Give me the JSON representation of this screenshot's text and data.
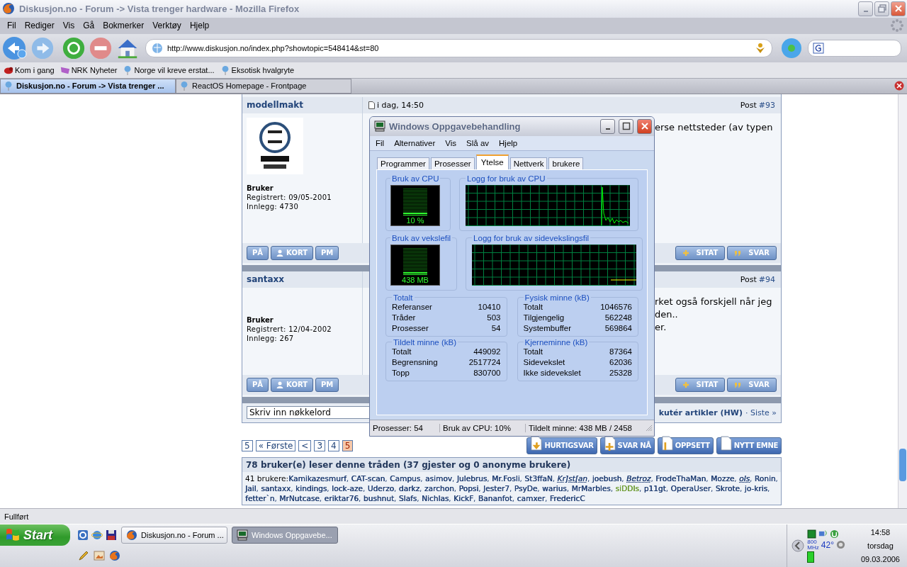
{
  "browser": {
    "title": "Diskusjon.no - Forum -> Vista trenger hardware - Mozilla Firefox",
    "menu": [
      "Fil",
      "Rediger",
      "Vis",
      "Gå",
      "Bokmerker",
      "Verktøy",
      "Hjelp"
    ],
    "url": "http://www.diskusjon.no/index.php?showtopic=548414&st=80",
    "bookmarks": [
      "Kom i gang",
      "NRK Nyheter",
      "Norge vil kreve erstat...",
      "Eksotisk hvalgryte"
    ],
    "tabs": [
      {
        "label": "Diskusjon.no - Forum -> Vista trenger ...",
        "selected": true
      },
      {
        "label": "ReactOS Homepage - Frontpage",
        "selected": false
      }
    ],
    "status": "Fullført"
  },
  "forum": {
    "posts": [
      {
        "author": "modellmakt",
        "date": "i dag, 14:50",
        "post_word": "Post",
        "number": "#93",
        "avatar": {
          "kind": "picture"
        },
        "rank": "Bruker",
        "registered": "Registrert: 09/05-2001",
        "count": "Innlegg: 4730",
        "text_lines": [
          "erse nettsteder (av typen"
        ],
        "left_buttons": [
          "PÅ",
          "KORT",
          "PM"
        ],
        "right_buttons": [
          "SITAT",
          "SVAR"
        ]
      },
      {
        "author": "santaxx",
        "post_word": "Post",
        "number": "#94",
        "rank": "Bruker",
        "registered": "Registrert: 12/04-2002",
        "count": "Innlegg: 267",
        "text_lines": [
          "rket også forskjell når jeg",
          "den..",
          "er."
        ],
        "left_buttons": [
          "PÅ",
          "KORT",
          "PM"
        ],
        "right_buttons": [
          "SITAT",
          "SVAR"
        ]
      }
    ],
    "search": {
      "placeholder": "Skriv inn nøkkelord"
    },
    "forum_link": "kutér artikler (HW)",
    "last_link": "· Siste »",
    "pages": [
      {
        "label": "5",
        "selected": false
      },
      {
        "label": "« Første",
        "selected": false
      },
      {
        "label": "<",
        "selected": false
      },
      {
        "label": "3",
        "selected": false
      },
      {
        "label": "4",
        "selected": false
      },
      {
        "label": "5",
        "selected": true
      }
    ],
    "actions": [
      "HURTIGSVAR",
      "SVAR NÅ",
      "OPPSETT",
      "NYTT EMNE"
    ],
    "readers": {
      "title": "78 bruker(e) leser denne tråden (37 gjester og 0 anonyme brukere)",
      "prefix": "41 brukere:",
      "separator": ",",
      "users": [
        {
          "name": "Kamikazesmurf",
          "italic": false,
          "color": "#1f3d72"
        },
        {
          "name": "CAT-scan",
          "italic": false,
          "color": "#1f3d72"
        },
        {
          "name": "Campus",
          "italic": false,
          "color": "#1f3d72"
        },
        {
          "name": "asimov",
          "italic": false,
          "color": "#1f3d72"
        },
        {
          "name": "Julebrus",
          "italic": false,
          "color": "#1f3d72"
        },
        {
          "name": "Mr.Fosli",
          "italic": false,
          "color": "#1f3d72"
        },
        {
          "name": "St3ffaN",
          "italic": false,
          "color": "#1f3d72"
        },
        {
          "name": "Kr]st[an",
          "italic": true,
          "color": "#1f3d72"
        },
        {
          "name": "joebush",
          "italic": false,
          "color": "#1f3d72"
        },
        {
          "name": "Betroz",
          "italic": true,
          "color": "#1f3d72"
        },
        {
          "name": "FrodeThaMan",
          "italic": false,
          "color": "#1f3d72"
        },
        {
          "name": "Mozze",
          "italic": false,
          "color": "#1f3d72"
        },
        {
          "name": "ols",
          "italic": true,
          "color": "#1f3d72"
        },
        {
          "name": "Ronin",
          "italic": false,
          "color": "#1f3d72"
        },
        {
          "name": "Jail",
          "italic": false,
          "color": "#1f3d72"
        },
        {
          "name": "santaxx",
          "italic": false,
          "color": "#1f3d72"
        },
        {
          "name": "kindings",
          "italic": false,
          "color": "#1f3d72"
        },
        {
          "name": "lock-aze",
          "italic": false,
          "color": "#1f3d72"
        },
        {
          "name": "Uderzo",
          "italic": false,
          "color": "#1f3d72"
        },
        {
          "name": "darkz",
          "italic": false,
          "color": "#1f3d72"
        },
        {
          "name": "zarchon",
          "italic": false,
          "color": "#1f3d72"
        },
        {
          "name": "Popsi",
          "italic": false,
          "color": "#1f3d72"
        },
        {
          "name": "Jester7",
          "italic": false,
          "color": "#1f3d72"
        },
        {
          "name": "PsyDe",
          "italic": false,
          "color": "#1f3d72"
        },
        {
          "name": "warius",
          "italic": false,
          "color": "#1f3d72"
        },
        {
          "name": "MrMarbles",
          "italic": false,
          "color": "#1f3d72"
        },
        {
          "name": "siDDIs",
          "italic": false,
          "color": "#6a9a2c"
        },
        {
          "name": "p11gt",
          "italic": false,
          "color": "#1f3d72"
        },
        {
          "name": "OperaUser",
          "italic": false,
          "color": "#1f3d72"
        },
        {
          "name": "Skrote",
          "italic": false,
          "color": "#1f3d72"
        },
        {
          "name": "jo-kris",
          "italic": false,
          "color": "#1f3d72"
        },
        {
          "name": "fetter`n",
          "italic": false,
          "color": "#1f3d72"
        },
        {
          "name": "MrNutcase",
          "italic": false,
          "color": "#1f3d72"
        },
        {
          "name": "eriktar76",
          "italic": false,
          "color": "#1f3d72"
        },
        {
          "name": "bushnut",
          "italic": false,
          "color": "#1f3d72"
        },
        {
          "name": "Slafs",
          "italic": false,
          "color": "#1f3d72"
        },
        {
          "name": "Nichlas",
          "italic": false,
          "color": "#1f3d72"
        },
        {
          "name": "KickF",
          "italic": false,
          "color": "#1f3d72"
        },
        {
          "name": "Bananfot",
          "italic": false,
          "color": "#1f3d72"
        },
        {
          "name": "camxer",
          "italic": false,
          "color": "#1f3d72"
        },
        {
          "name": "FredericC",
          "italic": false,
          "color": "#1f3d72"
        }
      ]
    }
  },
  "taskmgr": {
    "title": "Windows Oppgavebehandling",
    "menu": [
      "Fil",
      "Alternativer",
      "Vis",
      "Slå av",
      "Hjelp"
    ],
    "tabs": [
      {
        "label": "Programmer",
        "selected": false
      },
      {
        "label": "Prosesser",
        "selected": false
      },
      {
        "label": "Ytelse",
        "selected": true
      },
      {
        "label": "Nettverk",
        "selected": false
      },
      {
        "label": "brukere",
        "selected": false
      }
    ],
    "cpu": {
      "title": "Bruk av CPU",
      "reading": "10 %",
      "level": 0.1
    },
    "cpu_history": {
      "title": "Logg for bruk av CPU"
    },
    "pagefile": {
      "title": "Bruk av vekslefil",
      "reading": "438 MB",
      "level": 0.1
    },
    "pagefile_history": {
      "title": "Logg for bruk av sidevekslingsfil"
    },
    "groups": [
      {
        "title": "Totalt",
        "rows": [
          {
            "label": "Referanser",
            "value": "10410"
          },
          {
            "label": "Tråder",
            "value": "503"
          },
          {
            "label": "Prosesser",
            "value": "54"
          }
        ]
      },
      {
        "title": "Fysisk minne (kB)",
        "rows": [
          {
            "label": "Totalt",
            "value": "1046576"
          },
          {
            "label": "Tilgjengelig",
            "value": "562248"
          },
          {
            "label": "Systembuffer",
            "value": "569864"
          }
        ]
      },
      {
        "title": "Tildelt minne (kB)",
        "rows": [
          {
            "label": "Totalt",
            "value": "449092"
          },
          {
            "label": "Begrensning",
            "value": "2517724"
          },
          {
            "label": "Topp",
            "value": "830700"
          }
        ]
      },
      {
        "title": "Kjerneminne (kB)",
        "rows": [
          {
            "label": "Totalt",
            "value": "87364"
          },
          {
            "label": "Sidevekslet",
            "value": "62036"
          },
          {
            "label": "Ikke sidevekslet",
            "value": "25328"
          }
        ]
      }
    ],
    "status": [
      "Prosesser: 54",
      "Bruk av CPU: 10%",
      "Tildelt minne: 438 MB / 2458"
    ]
  },
  "taskbar": {
    "start": "Start",
    "tasks": [
      {
        "label": "Diskusjon.no - Forum ...",
        "selected": false
      },
      {
        "label": "Windows Oppgavebe...",
        "selected": true
      }
    ],
    "cpu_speed": "800",
    "cpu_unit": "MHz",
    "temperature": "42°",
    "time": "14:58",
    "day": "torsdag",
    "date": "09.03.2006"
  }
}
